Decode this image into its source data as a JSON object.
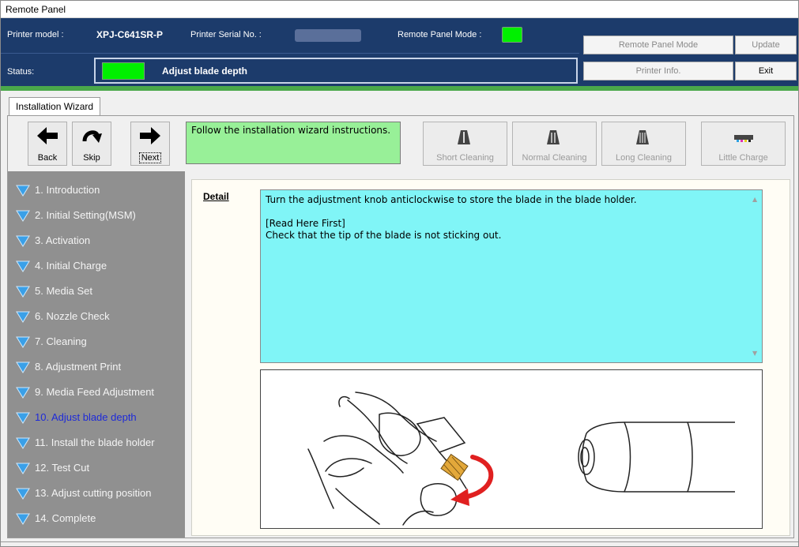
{
  "window": {
    "title": "Remote Panel"
  },
  "header": {
    "printer_model_label": "Printer model :",
    "printer_model": "XPJ-C641SR-P",
    "serial_label": "Printer Serial No. :",
    "remote_mode_label": "Remote Panel Mode :",
    "status_label": "Status:",
    "status_text": "Adjust blade depth",
    "led_color": "#00f000",
    "buttons": {
      "remote_panel_mode": "Remote Panel Mode",
      "update": "Update",
      "printer_info": "Printer Info.",
      "exit": "Exit"
    }
  },
  "tab": {
    "label": "Installation Wizard"
  },
  "toolbar": {
    "back": "Back",
    "skip": "Skip",
    "next": "Next",
    "instruction": "Follow the installation wizard instructions.",
    "short_cleaning": "Short Cleaning",
    "normal_cleaning": "Normal Cleaning",
    "long_cleaning": "Long Cleaning",
    "little_charge": "Little Charge"
  },
  "steps": [
    {
      "label": "1. Introduction"
    },
    {
      "label": "2. Initial Setting(MSM)"
    },
    {
      "label": "3. Activation"
    },
    {
      "label": "4. Initial Charge"
    },
    {
      "label": "5. Media Set"
    },
    {
      "label": "6. Nozzle Check"
    },
    {
      "label": "7. Cleaning"
    },
    {
      "label": "8. Adjustment Print"
    },
    {
      "label": "9. Media Feed Adjustment"
    },
    {
      "label": "10. Adjust blade depth",
      "current": true
    },
    {
      "label": "11. Install the blade holder"
    },
    {
      "label": "12. Test Cut"
    },
    {
      "label": "13. Adjust cutting position"
    },
    {
      "label": "14. Complete"
    }
  ],
  "detail": {
    "label": "Detail",
    "text": "Turn the adjustment knob anticlockwise to store the blade in the blade holder.\n\n[Read Here First]\nCheck that the tip of the blade is not sticking out."
  },
  "colors": {
    "header_bg": "#1c3b6b",
    "accent_green": "#4aa84a",
    "instruction_bg": "#98f098",
    "detail_bg": "#80f5f7",
    "sidebar_bg": "#909090",
    "step_icon": "#3aa0e8",
    "current_step": "#1e2ad8"
  }
}
